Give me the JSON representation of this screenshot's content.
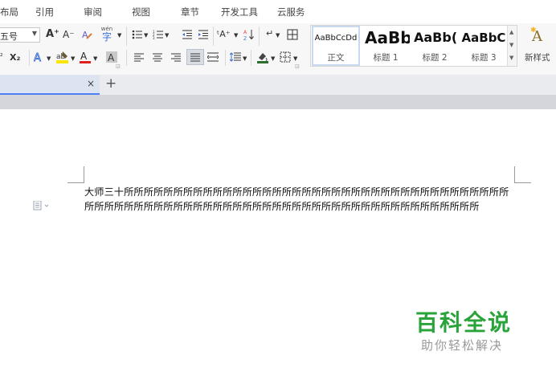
{
  "menu": {
    "items": [
      "布局",
      "引用",
      "审阅",
      "视图",
      "章节",
      "开发工具",
      "云服务"
    ]
  },
  "ribbon": {
    "font_size_value": "五号",
    "btn_grow": "A⁺",
    "btn_shrink": "A⁻",
    "pinyin_label": "wén",
    "superscript": "²",
    "subscript": "X₂",
    "styles": [
      {
        "sample": "AaBbCcDd",
        "label": "正文"
      },
      {
        "sample": "AaBb",
        "label": "标题 1"
      },
      {
        "sample": "AaBb(",
        "label": "标题 2"
      },
      {
        "sample": "AaBbC",
        "label": "标题 3"
      }
    ],
    "new_style_label": "新样式"
  },
  "tabs": {
    "close": "×",
    "add": "+"
  },
  "document": {
    "line1": "大师三十所所所所所所所所所所所所所所所所所所所所所所所所所所所所所所所所所所所所所所所",
    "line2": "所所所所所所所所所所所所所所所所所所所所所所所所所所所所所所所所所所所所所所所所"
  },
  "watermark": {
    "title": "百科全说",
    "subtitle": "助你轻松解决"
  },
  "colors": {
    "accent": "#4f7ff0",
    "watermark_green": "#2aa33b",
    "font_color_red": "#e02020",
    "highlight_yellow": "#ffe600",
    "text_effect_blue": "#3b6fd8"
  }
}
